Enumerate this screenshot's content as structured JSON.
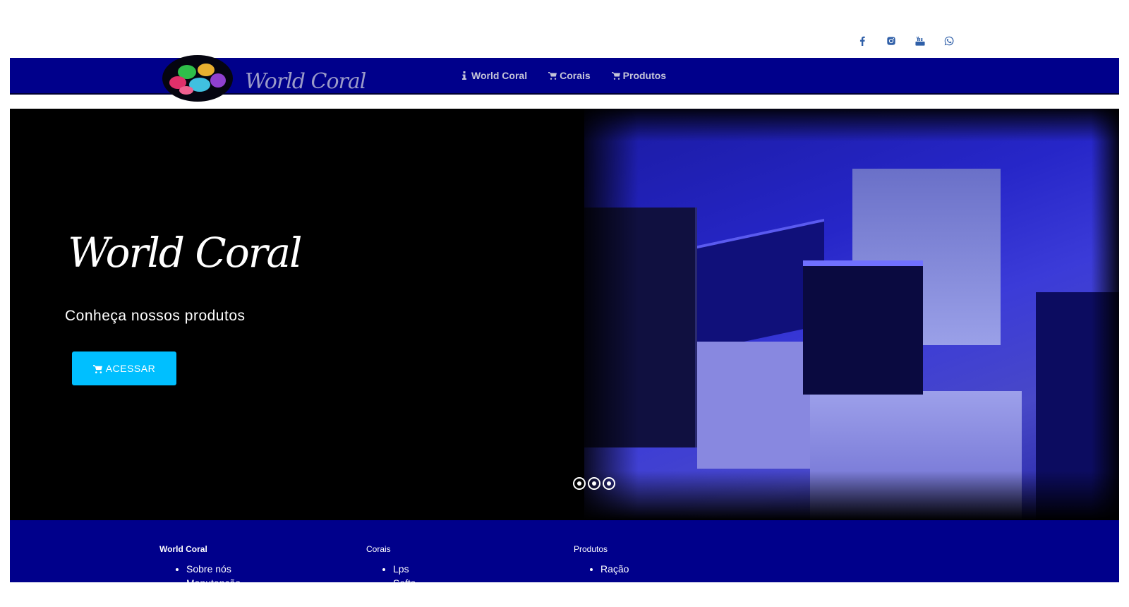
{
  "social": {
    "icons": [
      "facebook-icon",
      "instagram-icon",
      "youtube-icon",
      "whatsapp-icon"
    ]
  },
  "nav": {
    "brand": "World Coral",
    "items": [
      {
        "label": "World Coral",
        "icon": "info-icon"
      },
      {
        "label": "Corais",
        "icon": "cart-icon"
      },
      {
        "label": "Produtos",
        "icon": "cart-icon"
      }
    ]
  },
  "hero": {
    "title": "World Coral",
    "subtitle": "Conheça nossos produtos",
    "button_label": "ACESSAR",
    "slides": 3
  },
  "footer": {
    "columns": [
      {
        "title": "World Coral",
        "items": [
          "Sobre nós",
          "Manutenção"
        ]
      },
      {
        "title": "Corais",
        "items": [
          "Lps",
          "Softs"
        ]
      },
      {
        "title": "Produtos",
        "items": [
          "Ração"
        ]
      }
    ]
  },
  "colors": {
    "nav_bg": "#00008b",
    "accent_button": "#00bfff",
    "social_icon": "#2f5fa8"
  }
}
